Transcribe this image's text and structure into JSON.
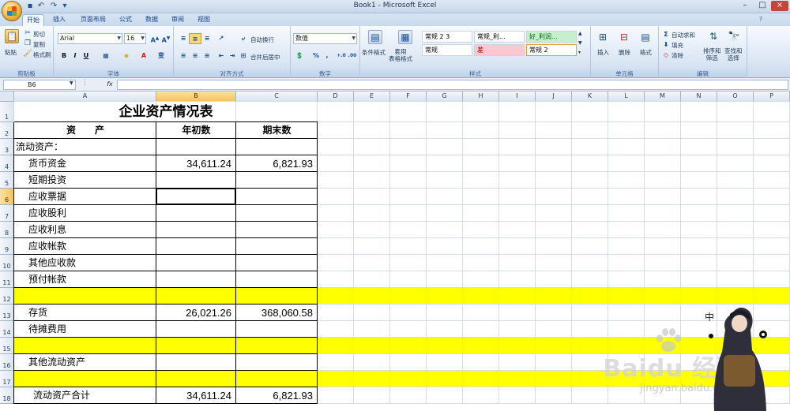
{
  "window": {
    "title": "Book1 - Microsoft Excel"
  },
  "tabs": [
    {
      "label": "开始",
      "active": true
    },
    {
      "label": "插入"
    },
    {
      "label": "页面布局"
    },
    {
      "label": "公式"
    },
    {
      "label": "数据"
    },
    {
      "label": "审阅"
    },
    {
      "label": "视图"
    }
  ],
  "ribbon": {
    "clipboard": {
      "paste": "粘贴",
      "cut": "剪切",
      "copy": "复制",
      "format_painter": "格式刷",
      "label": "剪贴板"
    },
    "font": {
      "name": "Arial",
      "size": "16",
      "label": "字体"
    },
    "alignment": {
      "wrap": "自动换行",
      "merge": "合并后居中",
      "label": "对齐方式"
    },
    "number": {
      "format": "数值",
      "label": "数字"
    },
    "styles": {
      "conditional": "条件格式",
      "table": "套用\n表格格式",
      "label": "样式",
      "cells": [
        {
          "name": "常规 2 3",
          "bg": "#ffffff",
          "fg": "#000000"
        },
        {
          "name": "常规_利...",
          "bg": "#ffffff",
          "fg": "#000000"
        },
        {
          "name": "好_利润...",
          "bg": "#c6efce",
          "fg": "#006100"
        },
        {
          "name": "常规",
          "bg": "#ffffff",
          "fg": "#000000"
        },
        {
          "name": "差",
          "bg": "#ffc7ce",
          "fg": "#9c0006"
        },
        {
          "name": "常规 2",
          "bg": "#ffffff",
          "fg": "#000000"
        }
      ]
    },
    "cells": {
      "insert": "插入",
      "delete": "删除",
      "format": "格式",
      "label": "单元格"
    },
    "editing": {
      "autosum": "自动求和",
      "fill": "填充",
      "clear": "清除",
      "sort": "排序和\n筛选",
      "find": "查找和\n选择",
      "label": "编辑"
    }
  },
  "formula_bar": {
    "name_box": "B6",
    "fx": "fx",
    "value": ""
  },
  "columns": [
    "A",
    "B",
    "C",
    "D",
    "E",
    "F",
    "G",
    "H",
    "I",
    "J",
    "K",
    "L",
    "M",
    "N",
    "O",
    "P"
  ],
  "rows": [
    "1",
    "2",
    "3",
    "4",
    "5",
    "6",
    "7",
    "8",
    "9",
    "10",
    "11",
    "12",
    "13",
    "14",
    "15",
    "16",
    "17",
    "18"
  ],
  "sheet": {
    "title": "企业资产情况表",
    "headers": [
      "资　　产",
      "年初数",
      "期末数"
    ],
    "lines": [
      {
        "label": "流动资产：",
        "indent": 0,
        "b": "",
        "c": ""
      },
      {
        "label": "货币资金",
        "indent": 1,
        "b": "34,611.24",
        "c": "6,821.93"
      },
      {
        "label": "短期投资",
        "indent": 1,
        "b": "",
        "c": ""
      },
      {
        "label": "应收票据",
        "indent": 1,
        "b": "",
        "c": ""
      },
      {
        "label": "应收股利",
        "indent": 1,
        "b": "",
        "c": ""
      },
      {
        "label": "应收利息",
        "indent": 1,
        "b": "",
        "c": ""
      },
      {
        "label": "应收帐款",
        "indent": 1,
        "b": "",
        "c": ""
      },
      {
        "label": "其他应收款",
        "indent": 1,
        "b": "",
        "c": ""
      },
      {
        "label": "预付帐款",
        "indent": 1,
        "b": "",
        "c": ""
      },
      {
        "label": "",
        "indent": 0,
        "b": "",
        "c": "",
        "highlight": true
      },
      {
        "label": "存货",
        "indent": 1,
        "b": "26,021.26",
        "c": "368,060.58"
      },
      {
        "label": "待摊费用",
        "indent": 1,
        "b": "",
        "c": ""
      },
      {
        "label": "",
        "indent": 0,
        "b": "",
        "c": "",
        "highlight": true
      },
      {
        "label": "其他流动资产",
        "indent": 1,
        "b": "",
        "c": ""
      },
      {
        "label": "",
        "indent": 0,
        "b": "",
        "c": "",
        "highlight": true
      },
      {
        "label": "流动资产合计",
        "indent": 2,
        "b": "34,611.24",
        "c": "6,821.93"
      }
    ],
    "highlight_color": "#ffff00",
    "selected_cell": "B6"
  },
  "overlay": {
    "ime_char": "中"
  },
  "watermark": {
    "logo": "Baidu 经验",
    "url": "jingyan.baidu.com"
  }
}
